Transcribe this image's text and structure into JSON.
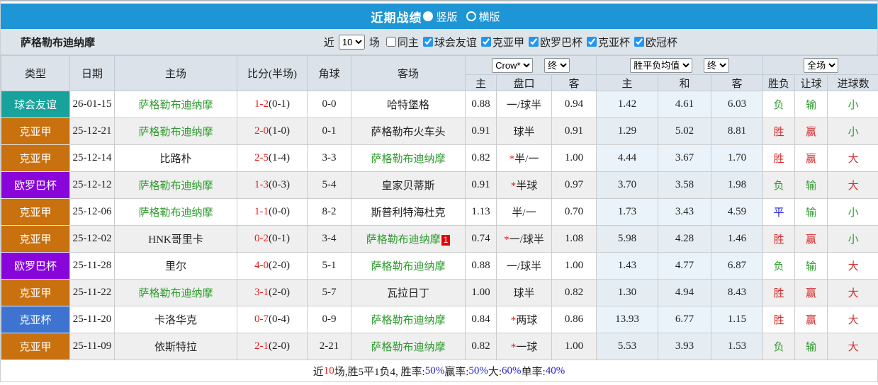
{
  "titlebar": {
    "title": "近期战绩",
    "view_options": [
      {
        "label": "竖版",
        "selected": true
      },
      {
        "label": "横版",
        "selected": false
      }
    ]
  },
  "filterbar": {
    "team": "萨格勒布迪纳摩",
    "recent_label": "近",
    "recent_value": "10",
    "recent_suffix": "场",
    "checkboxes": [
      {
        "label": "同主",
        "checked": false
      },
      {
        "label": "球会友谊",
        "checked": true
      },
      {
        "label": "克亚甲",
        "checked": true
      },
      {
        "label": "欧罗巴杯",
        "checked": true
      },
      {
        "label": "克亚杯",
        "checked": true
      },
      {
        "label": "欧冠杯",
        "checked": true
      }
    ]
  },
  "table": {
    "selects": {
      "company": "Crow*",
      "company_state": "终",
      "avg": "胜平负均值",
      "avg_state": "终",
      "scope": "全场"
    },
    "left_headers": [
      "类型",
      "日期",
      "主场",
      "比分(半场)",
      "角球",
      "客场"
    ],
    "sub_headers": [
      "主",
      "盘口",
      "客",
      "主",
      "和",
      "客",
      "胜负",
      "让球",
      "进球数"
    ],
    "type_colors": {
      "球会友谊": "#17a29b",
      "克亚甲": "#c8710e",
      "欧罗巴杯": "#8806d9",
      "克亚杯": "#3e74d0"
    },
    "verdict_colors": {
      "胜": "#d42b2b",
      "平": "#2525d2",
      "负": "#2e9b2e",
      "赢": "#d42b2b",
      "输": "#2e9b2e",
      "大": "#d42b2b",
      "小": "#2e9b2e"
    },
    "team_color": "#2e9b2e",
    "rows": [
      {
        "type": "球会友谊",
        "date": "26-01-15",
        "home": "萨格勒布迪纳摩",
        "home_is_team": true,
        "score": "1-2",
        "half": "(0-1)",
        "corner": "0-0",
        "away": "哈特堡格",
        "away_is_team": false,
        "away_badge": "",
        "h_home": "0.88",
        "handicap": "一/球半",
        "handicap_star": false,
        "h_away": "0.94",
        "avg_win": "1.42",
        "avg_draw": "4.61",
        "avg_lose": "6.03",
        "result": "负",
        "spread": "输",
        "goals": "小"
      },
      {
        "type": "克亚甲",
        "date": "25-12-21",
        "home": "萨格勒布迪纳摩",
        "home_is_team": true,
        "score": "2-0",
        "half": "(1-0)",
        "corner": "0-1",
        "away": "萨格勒布火车头",
        "away_is_team": false,
        "away_badge": "",
        "h_home": "0.91",
        "handicap": "球半",
        "handicap_star": false,
        "h_away": "0.91",
        "avg_win": "1.29",
        "avg_draw": "5.02",
        "avg_lose": "8.81",
        "result": "胜",
        "spread": "赢",
        "goals": "小"
      },
      {
        "type": "克亚甲",
        "date": "25-12-14",
        "home": "比路朴",
        "home_is_team": false,
        "score": "2-5",
        "half": "(1-4)",
        "corner": "3-3",
        "away": "萨格勒布迪纳摩",
        "away_is_team": true,
        "away_badge": "",
        "h_home": "0.82",
        "handicap": "半/一",
        "handicap_star": true,
        "h_away": "1.00",
        "avg_win": "4.44",
        "avg_draw": "3.67",
        "avg_lose": "1.70",
        "result": "胜",
        "spread": "赢",
        "goals": "大"
      },
      {
        "type": "欧罗巴杯",
        "date": "25-12-12",
        "home": "萨格勒布迪纳摩",
        "home_is_team": true,
        "score": "1-3",
        "half": "(0-3)",
        "corner": "5-4",
        "away": "皇家贝蒂斯",
        "away_is_team": false,
        "away_badge": "",
        "h_home": "0.91",
        "handicap": "半球",
        "handicap_star": true,
        "h_away": "0.97",
        "avg_win": "3.70",
        "avg_draw": "3.58",
        "avg_lose": "1.98",
        "result": "负",
        "spread": "输",
        "goals": "大"
      },
      {
        "type": "克亚甲",
        "date": "25-12-06",
        "home": "萨格勒布迪纳摩",
        "home_is_team": true,
        "score": "1-1",
        "half": "(0-0)",
        "corner": "8-2",
        "away": "斯普利特海杜克",
        "away_is_team": false,
        "away_badge": "",
        "h_home": "1.13",
        "handicap": "半/一",
        "handicap_star": false,
        "h_away": "0.70",
        "avg_win": "1.73",
        "avg_draw": "3.43",
        "avg_lose": "4.59",
        "result": "平",
        "spread": "输",
        "goals": "小"
      },
      {
        "type": "克亚甲",
        "date": "25-12-02",
        "home": "HNK哥里卡",
        "home_is_team": false,
        "score": "0-2",
        "half": "(0-1)",
        "corner": "3-4",
        "away": "萨格勒布迪纳摩",
        "away_is_team": true,
        "away_badge": "1",
        "h_home": "0.74",
        "handicap": "一/球半",
        "handicap_star": true,
        "h_away": "1.08",
        "avg_win": "5.98",
        "avg_draw": "4.28",
        "avg_lose": "1.46",
        "result": "胜",
        "spread": "赢",
        "goals": "小"
      },
      {
        "type": "欧罗巴杯",
        "date": "25-11-28",
        "home": "里尔",
        "home_is_team": false,
        "score": "4-0",
        "half": "(2-0)",
        "corner": "5-1",
        "away": "萨格勒布迪纳摩",
        "away_is_team": true,
        "away_badge": "",
        "h_home": "0.88",
        "handicap": "一/球半",
        "handicap_star": false,
        "h_away": "1.00",
        "avg_win": "1.43",
        "avg_draw": "4.77",
        "avg_lose": "6.87",
        "result": "负",
        "spread": "输",
        "goals": "大"
      },
      {
        "type": "克亚甲",
        "date": "25-11-22",
        "home": "萨格勒布迪纳摩",
        "home_is_team": true,
        "score": "3-1",
        "half": "(2-0)",
        "corner": "5-7",
        "away": "瓦拉日丁",
        "away_is_team": false,
        "away_badge": "",
        "h_home": "1.00",
        "handicap": "球半",
        "handicap_star": false,
        "h_away": "0.82",
        "avg_win": "1.30",
        "avg_draw": "4.94",
        "avg_lose": "8.43",
        "result": "胜",
        "spread": "赢",
        "goals": "大"
      },
      {
        "type": "克亚杯",
        "date": "25-11-20",
        "home": "卡洛华克",
        "home_is_team": false,
        "score": "0-7",
        "half": "(0-4)",
        "corner": "0-9",
        "away": "萨格勒布迪纳摩",
        "away_is_team": true,
        "away_badge": "",
        "h_home": "0.84",
        "handicap": "两球",
        "handicap_star": true,
        "h_away": "0.86",
        "avg_win": "13.93",
        "avg_draw": "6.77",
        "avg_lose": "1.15",
        "result": "胜",
        "spread": "赢",
        "goals": "大"
      },
      {
        "type": "克亚甲",
        "date": "25-11-09",
        "home": "依斯特拉",
        "home_is_team": false,
        "score": "2-1",
        "half": "(2-0)",
        "corner": "2-21",
        "away": "萨格勒布迪纳摩",
        "away_is_team": true,
        "away_badge": "",
        "h_home": "0.82",
        "handicap": "一球",
        "handicap_star": true,
        "h_away": "1.00",
        "avg_win": "5.53",
        "avg_draw": "3.93",
        "avg_lose": "1.53",
        "result": "负",
        "spread": "输",
        "goals": "大"
      }
    ]
  },
  "footer": {
    "parts": [
      {
        "text": "近",
        "color": "#222222"
      },
      {
        "text": "10",
        "color": "#e61e1e"
      },
      {
        "text": "场,胜5平1负4, 胜率:",
        "color": "#222222"
      },
      {
        "text": "50%",
        "color": "#2525d2"
      },
      {
        "text": " 赢率:",
        "color": "#222222"
      },
      {
        "text": "50%",
        "color": "#2525d2"
      },
      {
        "text": " 大:",
        "color": "#222222"
      },
      {
        "text": "60%",
        "color": "#2525d2"
      },
      {
        "text": " 单率:",
        "color": "#222222"
      },
      {
        "text": "40%",
        "color": "#2525d2"
      }
    ]
  }
}
